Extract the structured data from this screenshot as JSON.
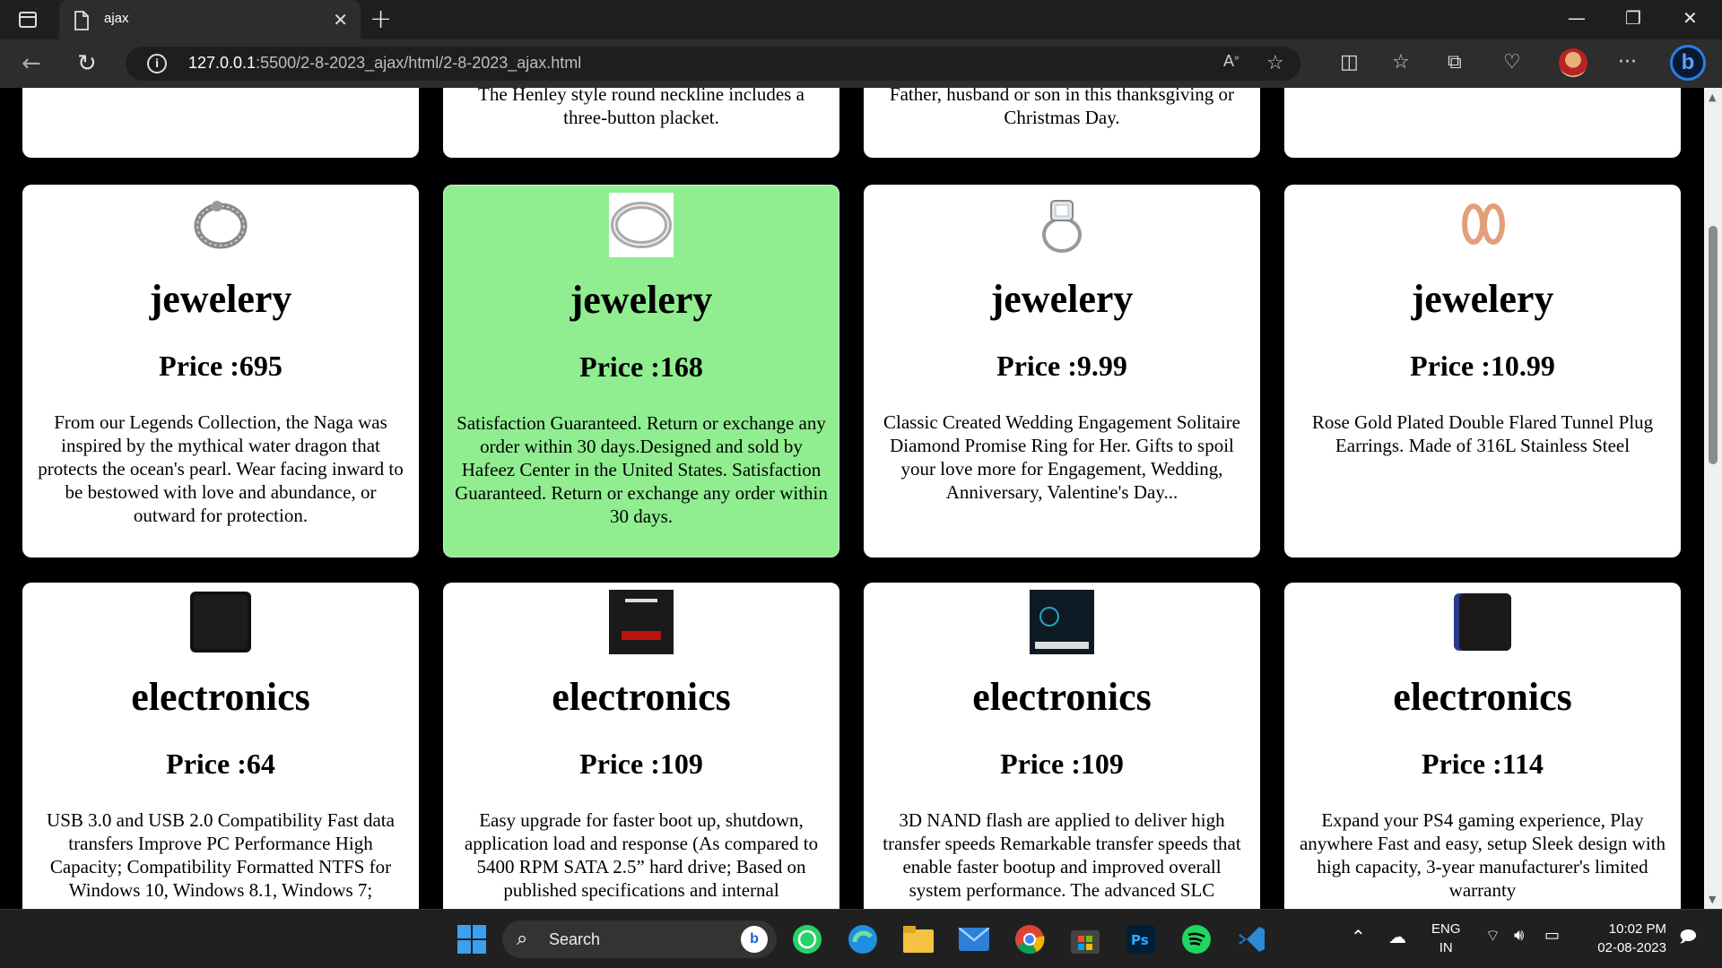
{
  "browser": {
    "tab_title": "ajax",
    "url_host": "127.0.0.1",
    "url_path": ":5500/2-8-2023_ajax/html/2-8-2023_ajax.html"
  },
  "top_partial": [
    "",
    "The Henley style round neckline includes a three-button placket.",
    "Father, husband or son in this thanksgiving or Christmas Day.",
    ""
  ],
  "products_row1": [
    {
      "category": "jewelery",
      "price": "Price :695",
      "description": "From our Legends Collection, the Naga was inspired by the mythical water dragon that protects the ocean's pearl. Wear facing inward to be bestowed with love and abundance, or outward for protection.",
      "icon": "silver-dragon-bracelet-icon"
    },
    {
      "category": "jewelery",
      "price": "Price :168",
      "description": "Satisfaction Guaranteed. Return or exchange any order within 30 days.Designed and sold by Hafeez Center in the United States. Satisfaction Guaranteed. Return or exchange any order within 30 days.",
      "icon": "silver-ring-icon"
    },
    {
      "category": "jewelery",
      "price": "Price :9.99",
      "description": "Classic Created Wedding Engagement Solitaire Diamond Promise Ring for Her. Gifts to spoil your love more for Engagement, Wedding, Anniversary, Valentine's Day...",
      "icon": "diamond-ring-icon"
    },
    {
      "category": "jewelery",
      "price": "Price :10.99",
      "description": "Rose Gold Plated Double Flared Tunnel Plug Earrings. Made of 316L Stainless Steel",
      "icon": "rose-gold-plug-icon"
    }
  ],
  "products_row2": [
    {
      "category": "electronics",
      "price": "Price :64",
      "description": "USB 3.0 and USB 2.0 Compatibility Fast data transfers Improve PC Performance High Capacity; Compatibility Formatted NTFS for Windows 10, Windows 8.1, Windows 7;",
      "icon": "external-hard-drive-icon"
    },
    {
      "category": "electronics",
      "price": "Price :109",
      "description": "Easy upgrade for faster boot up, shutdown, application load and response (As compared to 5400 RPM SATA 2.5” hard drive; Based on published specifications and internal",
      "icon": "sandisk-ssd-icon"
    },
    {
      "category": "electronics",
      "price": "Price :109",
      "description": "3D NAND flash are applied to deliver high transfer speeds Remarkable transfer speeds that enable faster bootup and improved overall system performance. The advanced SLC",
      "icon": "nand-ssd-icon"
    },
    {
      "category": "electronics",
      "price": "Price :114",
      "description": "Expand your PS4 gaming experience, Play anywhere Fast and easy, setup Sleek design with high capacity, 3-year manufacturer's limited warranty",
      "icon": "gaming-drive-icon"
    }
  ],
  "taskbar": {
    "search_label": "Search",
    "lang_line1": "ENG",
    "lang_line2": "IN",
    "time": "10:02 PM",
    "date": "02-08-2023"
  }
}
